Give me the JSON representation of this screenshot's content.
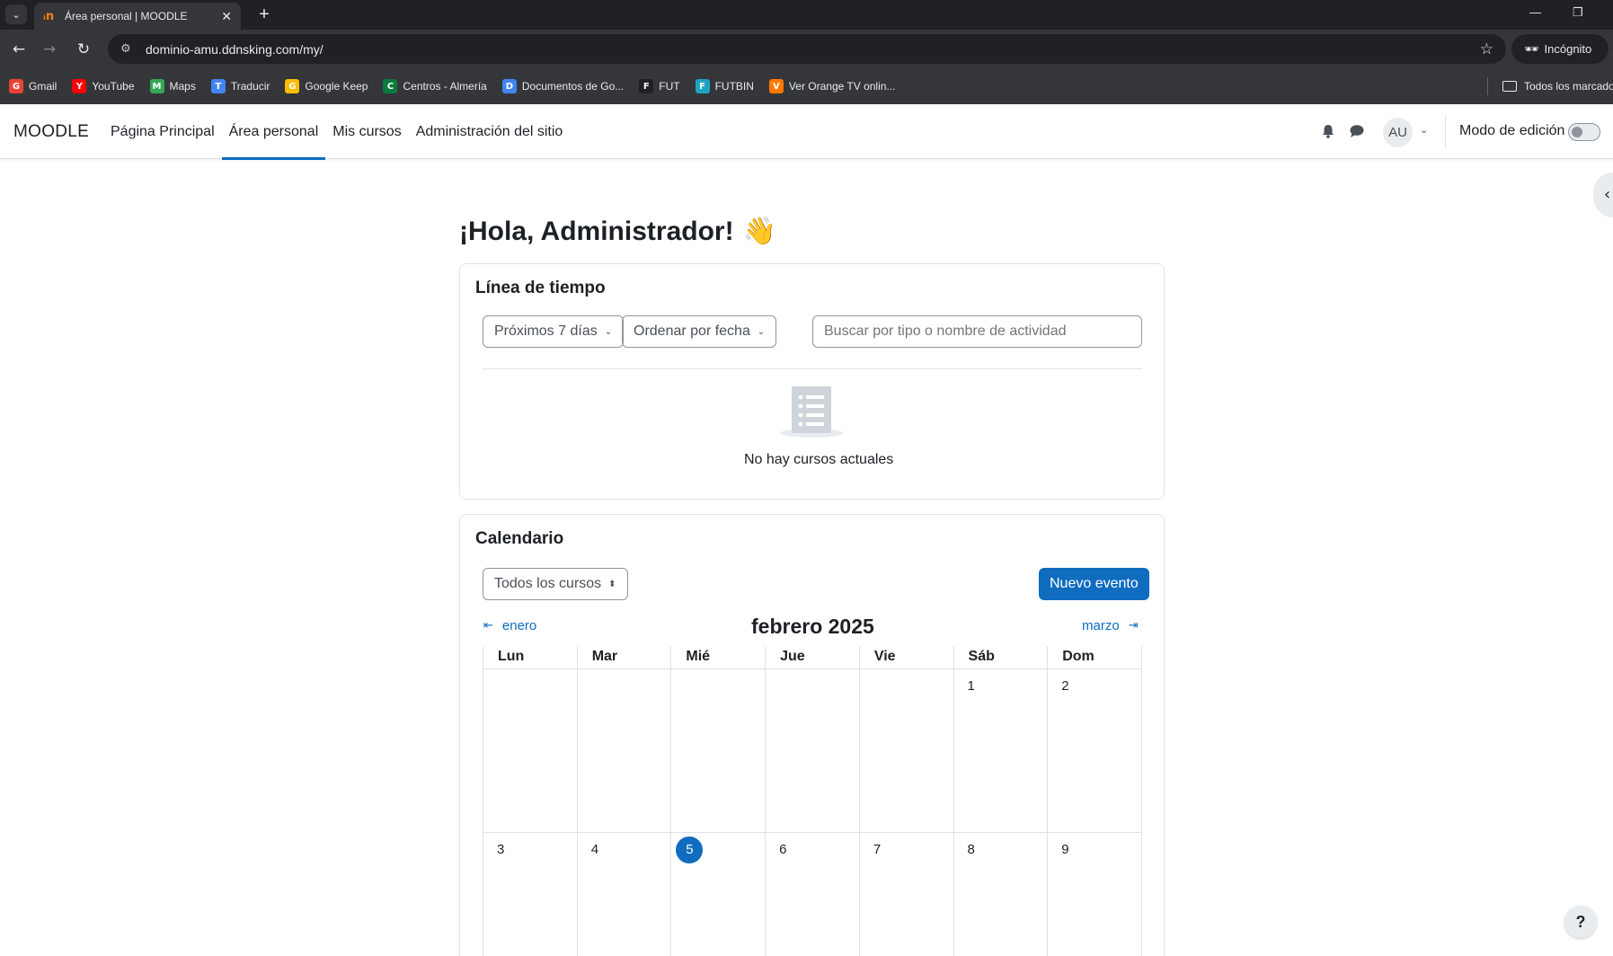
{
  "browser": {
    "tab_title": "Área personal | MOODLE",
    "favicon": "moodle-favicon",
    "new_tab": "+",
    "url": "dominio-amu.ddnsking.com/my/",
    "incognito_label": "Incógnito",
    "bookmarks": [
      {
        "label": "Gmail",
        "icon": "gmail-icon",
        "color": "#ea4335"
      },
      {
        "label": "YouTube",
        "icon": "youtube-icon",
        "color": "#ff0000"
      },
      {
        "label": "Maps",
        "icon": "maps-icon",
        "color": "#34a853"
      },
      {
        "label": "Traducir",
        "icon": "translate-icon",
        "color": "#4285f4"
      },
      {
        "label": "Google Keep",
        "icon": "keep-icon",
        "color": "#fbbc04"
      },
      {
        "label": "Centros - Almería",
        "icon": "centros-icon",
        "color": "#0a7a3d"
      },
      {
        "label": "Documentos de Go...",
        "icon": "docs-icon",
        "color": "#4285f4"
      },
      {
        "label": "FUT",
        "icon": "fut-icon",
        "color": "#202124"
      },
      {
        "label": "FUTBIN",
        "icon": "futbin-icon",
        "color": "#1fa3c4"
      },
      {
        "label": "Ver Orange TV onlin...",
        "icon": "orange-icon",
        "color": "#ff7900"
      }
    ],
    "all_bookmarks": "Todos los marcado"
  },
  "moodle": {
    "brand": "MOODLE",
    "nav": [
      {
        "label": "Página Principal",
        "active": false
      },
      {
        "label": "Área personal",
        "active": true
      },
      {
        "label": "Mis cursos",
        "active": false
      },
      {
        "label": "Administración del sitio",
        "active": false
      }
    ],
    "avatar_initials": "AU",
    "edit_mode_label": "Modo de edición",
    "edit_mode_on": false,
    "accent_color": "#0f6cbf"
  },
  "greeting": "¡Hola, Administrador!",
  "timeline": {
    "title": "Línea de tiempo",
    "filter_days": "Próximos 7 días",
    "sort": "Ordenar por fecha",
    "search_placeholder": "Buscar por tipo o nombre de actividad",
    "empty_text": "No hay cursos actuales"
  },
  "calendar": {
    "title": "Calendario",
    "course_filter": "Todos los cursos",
    "new_event": "Nuevo evento",
    "prev_month": "enero",
    "next_month": "marzo",
    "current_month": "febrero 2025",
    "weekdays": [
      "Lun",
      "Mar",
      "Mié",
      "Jue",
      "Vie",
      "Sáb",
      "Dom"
    ],
    "weeks": [
      [
        "",
        "",
        "",
        "",
        "",
        "1",
        "2"
      ],
      [
        "3",
        "4",
        "5",
        "6",
        "7",
        "8",
        "9"
      ]
    ],
    "today": "5"
  },
  "help_label": "?"
}
